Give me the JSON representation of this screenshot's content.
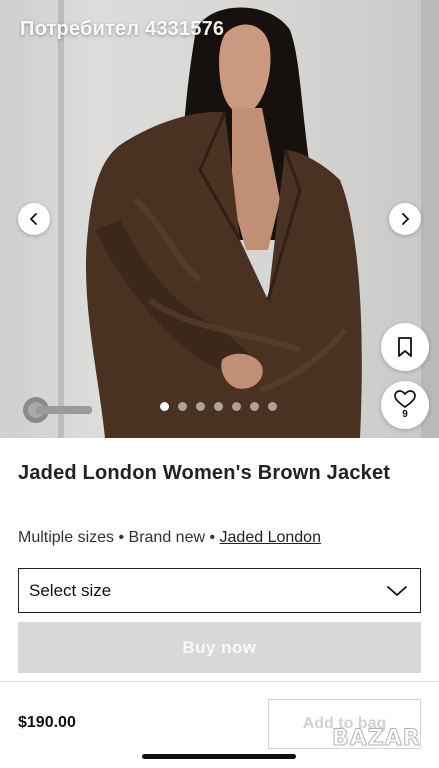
{
  "gallery": {
    "watermark_user": "Потребител 4331576",
    "image_count": 7,
    "active_image_index": 0,
    "favorites_count": "9",
    "icons": {
      "prev": "chevron-left-icon",
      "next": "chevron-right-icon",
      "save": "bookmark-icon",
      "favorite": "heart-icon"
    }
  },
  "product": {
    "title": "Jaded London Women's Brown Jacket",
    "size_info": "Multiple sizes",
    "condition": "Brand new",
    "brand": "Jaded London",
    "separator": " • "
  },
  "size_selector": {
    "placeholder": "Select size",
    "icon": "chevron-down-icon"
  },
  "actions": {
    "buy_label": "Buy now",
    "add_to_bag_label": "Add to bag",
    "price": "$190.00"
  },
  "watermark": {
    "logo_text": "BAZAR"
  },
  "colors": {
    "jacket": "#4a3222",
    "button_disabled": "#d8d8d8",
    "text": "#111111"
  }
}
